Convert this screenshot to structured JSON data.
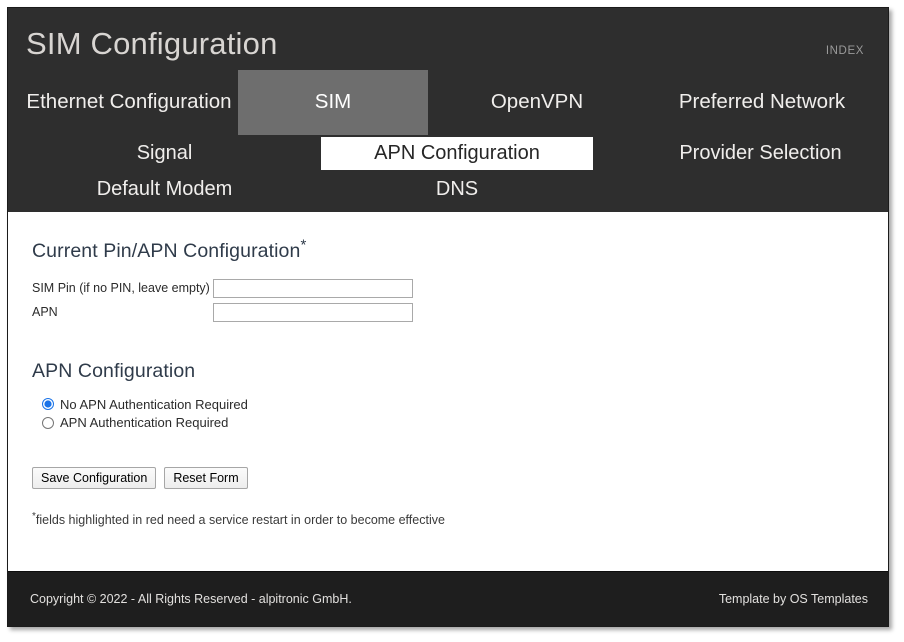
{
  "header": {
    "title": "SIM Configuration",
    "index_link": "INDEX"
  },
  "nav_primary": {
    "items": [
      {
        "label": "Ethernet Configuration",
        "active": false
      },
      {
        "label": "SIM",
        "active": true
      },
      {
        "label": "OpenVPN",
        "active": false
      },
      {
        "label": "Preferred Network",
        "active": false
      }
    ]
  },
  "nav_secondary": {
    "row1": [
      {
        "label": "Signal",
        "active": false
      },
      {
        "label": "APN Configuration",
        "active": true
      },
      {
        "label": "Provider Selection",
        "active": false
      }
    ],
    "row2": [
      {
        "label": "Default Modem",
        "active": false
      },
      {
        "label": "DNS",
        "active": false
      }
    ]
  },
  "content": {
    "section1_heading": "Current Pin/APN Configuration",
    "section1_asterisk": "*",
    "fields": [
      {
        "label": "SIM Pin (if no PIN, leave empty)",
        "value": "",
        "placeholder": ""
      },
      {
        "label": "APN",
        "value": "",
        "placeholder": ""
      }
    ],
    "section2_heading": "APN Configuration",
    "radios": [
      {
        "label": "No APN Authentication Required",
        "checked": true
      },
      {
        "label": "APN Authentication Required",
        "checked": false
      }
    ],
    "buttons": {
      "save": "Save Configuration",
      "reset": "Reset Form"
    },
    "footnote_asterisk": "*",
    "footnote": "fields highlighted in red need a service restart in order to become effective"
  },
  "footer": {
    "copyright": "Copyright © 2022 - All Rights Reserved - alpitronic GmbH.",
    "template_credit": "Template by OS Templates"
  },
  "colors": {
    "header_bg": "#2e2e2e",
    "footer_bg": "#1e1e1e",
    "active_tab_bg": "#6e6e6e",
    "active_subtab_bg": "#ffffff",
    "title_text": "#d8d5d2",
    "radio_accent": "#1a73e8",
    "heading_text": "#2f3b4a"
  }
}
